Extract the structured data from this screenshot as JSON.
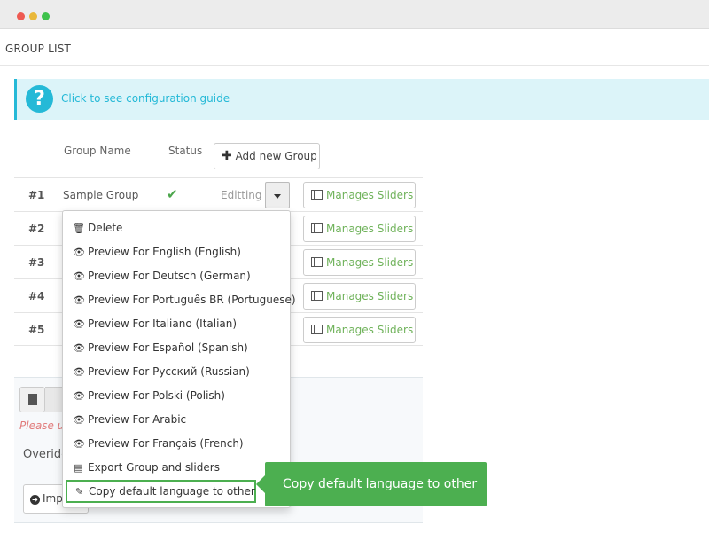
{
  "page": {
    "title": "GROUP LIST"
  },
  "guide": {
    "text": "Click to see configuration guide",
    "icon": "question-icon"
  },
  "table": {
    "headers": {
      "name": "Group Name",
      "status": "Status"
    },
    "add_button": "Add new Group",
    "rows": [
      {
        "num": "#1",
        "name": "Sample Group",
        "status": "active",
        "edit_label": "Editting",
        "manage_label": "Manages Sliders"
      },
      {
        "num": "#2",
        "manage_label": "Manages Sliders"
      },
      {
        "num": "#3",
        "manage_label": "Manages Sliders"
      },
      {
        "num": "#4",
        "manage_label": "Manages Sliders"
      },
      {
        "num": "#5",
        "manage_label": "Manages Sliders"
      }
    ]
  },
  "dropdown": {
    "items": [
      {
        "label": "Delete",
        "icon": "trash-icon"
      },
      {
        "label": "Preview For English (English)",
        "icon": "eye-icon"
      },
      {
        "label": "Preview For Deutsch (German)",
        "icon": "eye-icon"
      },
      {
        "label": "Preview For Português BR (Portuguese)",
        "icon": "eye-icon"
      },
      {
        "label": "Preview For Italiano (Italian)",
        "icon": "eye-icon"
      },
      {
        "label": "Preview For Español (Spanish)",
        "icon": "eye-icon"
      },
      {
        "label": "Preview For Русский (Russian)",
        "icon": "eye-icon"
      },
      {
        "label": "Preview For Polski (Polish)",
        "icon": "eye-icon"
      },
      {
        "label": "Preview For Arabic",
        "icon": "eye-icon"
      },
      {
        "label": "Preview For Français (French)",
        "icon": "eye-icon"
      },
      {
        "label": "Export Group and sliders",
        "icon": "archive-icon"
      },
      {
        "label": "Copy default language to other",
        "icon": "edit-icon"
      }
    ]
  },
  "tooltip": {
    "text": "Copy default language to other"
  },
  "lower": {
    "please_text": "Please up",
    "overide_text": "Overide",
    "import_label": "Imp"
  },
  "colors": {
    "accent": "#25b9d7",
    "success": "#4caf50",
    "link_green": "#6fb25a"
  }
}
